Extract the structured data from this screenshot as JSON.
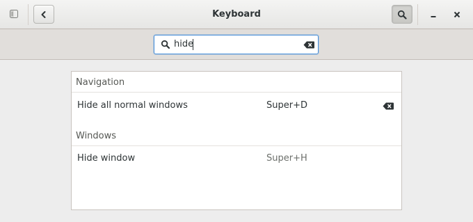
{
  "window": {
    "title": "Keyboard"
  },
  "search": {
    "value": "hide"
  },
  "sections": [
    {
      "header": "Navigation",
      "rows": [
        {
          "name": "Hide all normal windows",
          "accelerator": "Super+D",
          "modified": true
        }
      ]
    },
    {
      "header": "Windows",
      "rows": [
        {
          "name": "Hide window",
          "accelerator": "Super+H",
          "modified": false
        }
      ]
    }
  ],
  "icons": {
    "sidebar": "sidebar-toggle-icon",
    "back": "chevron-left-icon",
    "search": "search-icon",
    "minimize": "minimize-icon",
    "close": "close-icon",
    "clear": "clear-text-icon",
    "reset": "reset-shortcut-icon"
  },
  "colors": {
    "focus": "#4a90d9",
    "text": "#2e3436"
  }
}
